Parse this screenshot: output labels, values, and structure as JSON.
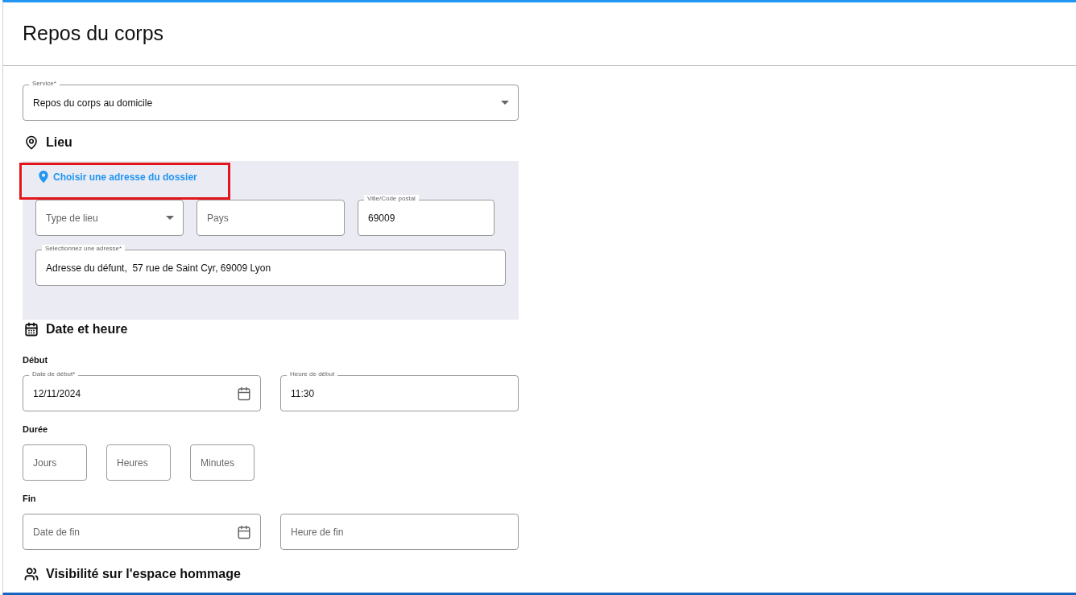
{
  "page": {
    "title": "Repos du corps"
  },
  "service": {
    "label": "Service*",
    "value": "Repos du corps au domicile",
    "kind": "select"
  },
  "lieu": {
    "heading": "Lieu",
    "link": "Choisir une adresse du dossier",
    "fields": [
      {
        "kind": "select",
        "placeholder": "Type de lieu"
      },
      {
        "kind": "text",
        "placeholder": "Pays"
      },
      {
        "kind": "text",
        "label": "Ville/Code postal",
        "value": "69009"
      }
    ],
    "address": {
      "kind": "text",
      "label": "Sélectionnez une adresse*",
      "value": "Adresse du défunt,  57 rue de Saint Cyr, 69009 Lyon"
    }
  },
  "date_heure": {
    "heading": "Date et heure",
    "groups": [
      {
        "label": "Début",
        "fields": [
          {
            "kind": "date",
            "label": "Date de début*",
            "value": "12/11/2024"
          },
          {
            "kind": "text",
            "label": "Heure de début",
            "value": "11:30"
          }
        ]
      },
      {
        "label": "Durée",
        "fields": [
          {
            "kind": "short",
            "placeholder": "Jours"
          },
          {
            "kind": "short",
            "placeholder": "Heures"
          },
          {
            "kind": "short",
            "placeholder": "Minutes"
          }
        ]
      },
      {
        "label": "Fin",
        "fields": [
          {
            "kind": "date",
            "placeholder": "Date de fin"
          },
          {
            "kind": "text",
            "placeholder": "Heure de fin"
          }
        ]
      }
    ]
  },
  "visibilite": {
    "heading": "Visibilité sur l'espace hommage"
  }
}
